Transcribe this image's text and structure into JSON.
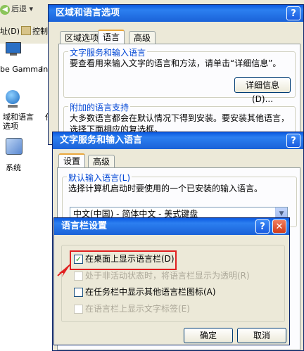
{
  "background": {
    "back_label": "后退",
    "menu_stub": "址(D)",
    "control_label": "控制",
    "items": [
      {
        "label": "be Gamma"
      },
      {
        "label": "Int"
      },
      {
        "label": "域和语言\n选项"
      },
      {
        "label": "系统"
      },
      {
        "label": "任"
      }
    ]
  },
  "regional_window": {
    "title": "区域和语言选项",
    "tabs": [
      "区域选项",
      "语言",
      "高级"
    ],
    "active_tab": "语言",
    "group1_title": "文字服务和输入语言",
    "group1_text": "要查看用来输入文字的语言和方法，请单击“详细信息”。",
    "details_button": "详细信息(D)...",
    "group2_title": "附加的语言支持",
    "group2_text": "大多数语言都会在默认情况下得到安装。要安装其他语言，选择下面相应的复选框。"
  },
  "text_services_window": {
    "title": "文字服务和输入语言",
    "tabs": [
      "设置",
      "高级"
    ],
    "active_tab": "设置",
    "group_title": "默认输入语言(L)",
    "group_text": "选择计算机启动时要使用的一个已安装的输入语言。",
    "default_language": "中文(中国) - 简体中文 - 美式键盘"
  },
  "language_bar_dialog": {
    "title": "语言栏设置",
    "options": [
      {
        "label": "在桌面上显示语言栏(D)",
        "checked": true,
        "enabled": true
      },
      {
        "label": "处于非活动状态时，将语言栏显示为透明(R)",
        "checked": false,
        "enabled": false
      },
      {
        "label": "在任务栏中显示其他语言栏图标(A)",
        "checked": false,
        "enabled": true
      },
      {
        "label": "在语言栏上显示文字标签(E)",
        "checked": false,
        "enabled": false
      }
    ],
    "ok_button": "确定",
    "cancel_button": "取消"
  },
  "colors": {
    "titlebar": "#1a62d8",
    "highlight": "#e02020"
  }
}
